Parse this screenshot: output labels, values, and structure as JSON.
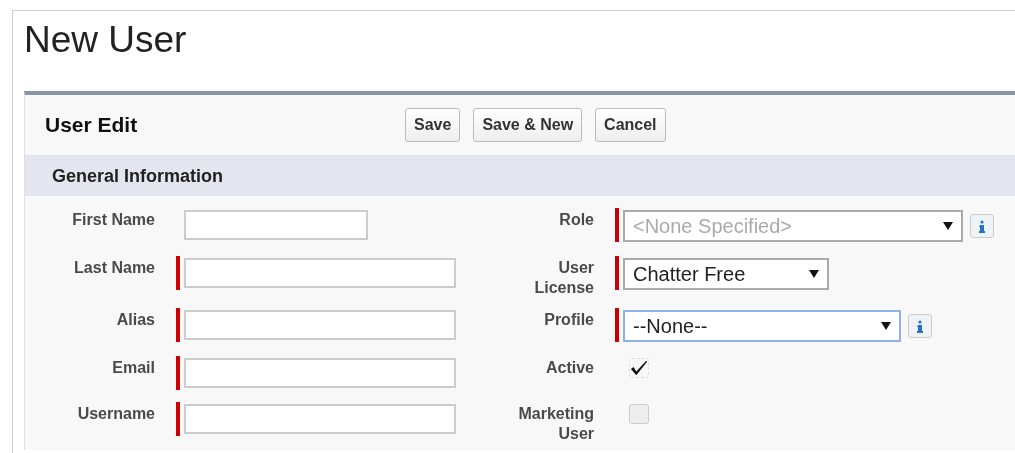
{
  "page_title": "New User",
  "panel": {
    "title": "User Edit",
    "buttons": [
      "Save",
      "Save & New",
      "Cancel"
    ]
  },
  "section": {
    "title": "General Information"
  },
  "left_fields": [
    {
      "label": "First Name",
      "required": false
    },
    {
      "label": "Last Name",
      "required": true
    },
    {
      "label": "Alias",
      "required": true
    },
    {
      "label": "Email",
      "required": true
    },
    {
      "label": "Username",
      "required": true
    }
  ],
  "right_fields": [
    {
      "kind": "select",
      "label": "Role",
      "required": true,
      "value": "<None Specified>",
      "disabled": true,
      "focused": false,
      "info": true
    },
    {
      "kind": "select",
      "label": "User License",
      "required": true,
      "value": "Chatter Free",
      "disabled": false,
      "focused": false,
      "info": false
    },
    {
      "kind": "select",
      "label": "Profile",
      "required": true,
      "value": "--None--",
      "disabled": false,
      "focused": true,
      "info": true
    },
    {
      "kind": "checkbox",
      "label": "Active",
      "checked": true
    },
    {
      "kind": "checkbox",
      "label": "Marketing User",
      "checked": false
    }
  ]
}
